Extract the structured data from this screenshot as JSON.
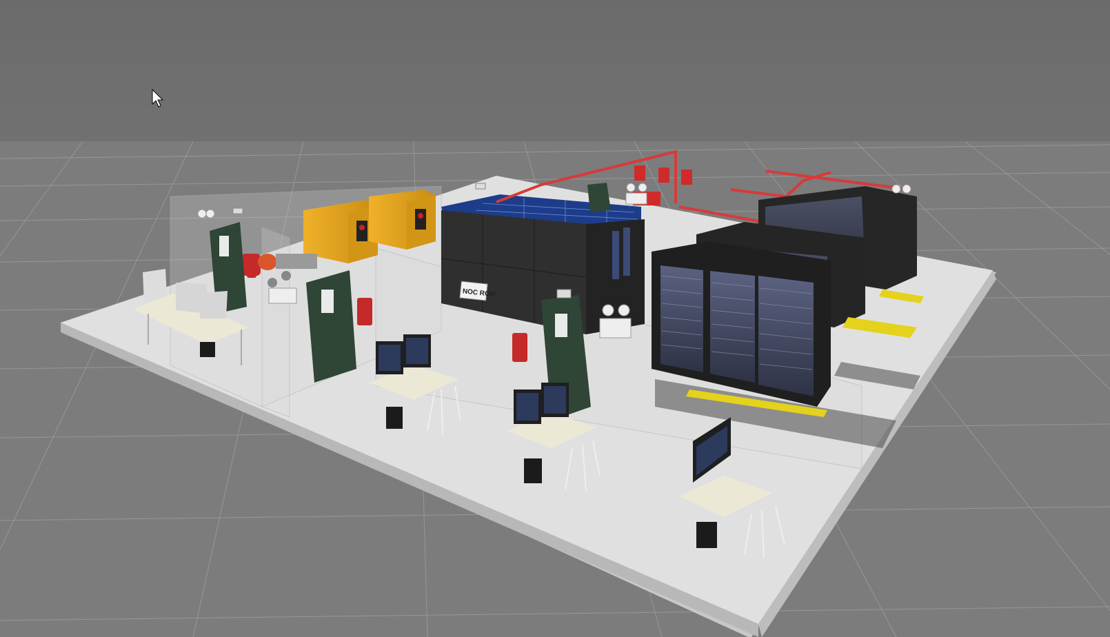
{
  "scene": {
    "description_label": "",
    "noc_room_sign": "NOC ROM"
  },
  "colors": {
    "background": "#7a7a7a",
    "grid_line": "#8e8e8e",
    "floor": "#dcdcdc",
    "floor_edge": "#c4c4c4",
    "rack_body": "#2a2a2a",
    "rack_panel": "#4a5068",
    "noc_body": "#2e2e2e",
    "generator": "#e6a21a",
    "pipe_red": "#d83a3a",
    "door_green": "#2f4536",
    "desk_top": "#ece8d6",
    "cable_tray_yellow": "#e4d21c",
    "blue_roof": "#1e3d8f"
  },
  "icons": {
    "cursor": "arrow-cursor-icon"
  }
}
